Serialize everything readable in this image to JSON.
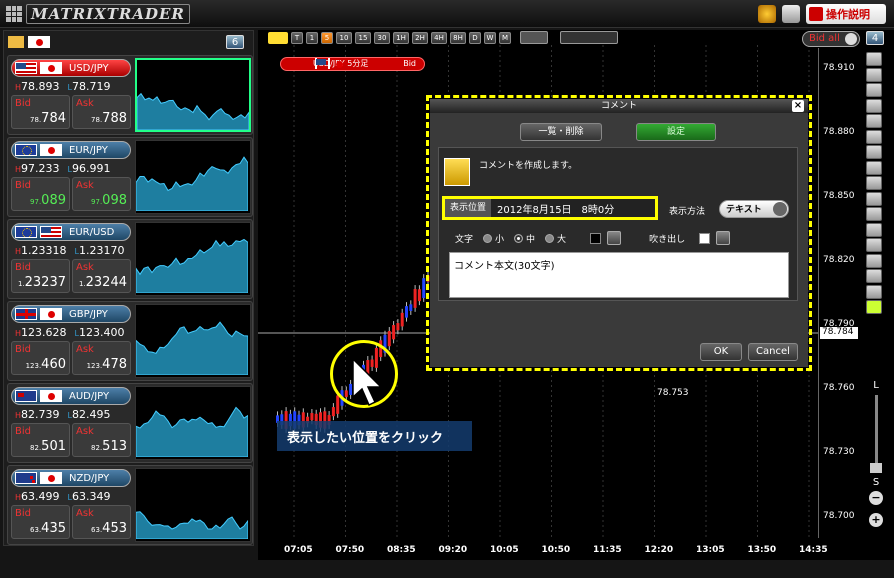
{
  "app": {
    "title": "MATRIXTRADER",
    "help_label": "操作説明"
  },
  "left_panel": {
    "count": "6",
    "pairs": [
      {
        "name": "USD/JPY",
        "flag1": "us",
        "flag2": "jp",
        "high": "78.893",
        "low": "78.719",
        "bid_prefix": "78.",
        "bid_main": "784",
        "ask_prefix": "78.",
        "ask_main": "788",
        "active": true
      },
      {
        "name": "EUR/JPY",
        "flag1": "eu",
        "flag2": "jp",
        "high": "97.233",
        "low": "96.991",
        "bid_prefix": "97.",
        "bid_main": "089",
        "ask_prefix": "97.",
        "ask_main": "098",
        "green": true
      },
      {
        "name": "EUR/USD",
        "flag1": "eu",
        "flag2": "us",
        "high": "1.23318",
        "low": "1.23170",
        "bid_prefix": "1.",
        "bid_main": "23237",
        "ask_prefix": "1.",
        "ask_main": "23244"
      },
      {
        "name": "GBP/JPY",
        "flag1": "gb",
        "flag2": "jp",
        "high": "123.628",
        "low": "123.400",
        "bid_prefix": "123.",
        "bid_main": "460",
        "ask_prefix": "123.",
        "ask_main": "478"
      },
      {
        "name": "AUD/JPY",
        "flag1": "au",
        "flag2": "jp",
        "high": "82.739",
        "low": "82.495",
        "bid_prefix": "82.",
        "bid_main": "501",
        "ask_prefix": "82.",
        "ask_main": "513"
      },
      {
        "name": "NZD/JPY",
        "flag1": "nz",
        "flag2": "jp",
        "high": "63.499",
        "low": "63.349",
        "bid_prefix": "63.",
        "bid_main": "435",
        "ask_prefix": "63.",
        "ask_main": "453"
      }
    ],
    "bid_label": "Bid",
    "ask_label": "Ask",
    "high_key": "H",
    "low_key": "L"
  },
  "chart": {
    "timeframes": [
      "T",
      "1",
      "5",
      "10",
      "15",
      "30",
      "1H",
      "2H",
      "4H",
      "8H",
      "D",
      "W",
      "M"
    ],
    "active_timeframe": "5",
    "bid_all_label": "Bid all",
    "chart_count": "4",
    "symbol_tag": "USD/JPY 5分足",
    "symbol_side": "Bid",
    "current_price": "78.784",
    "low_marker": "78.753",
    "callout": "表示したい位置をクリック",
    "zoom_l": "L",
    "zoom_s": "S"
  },
  "chart_data": {
    "type": "candlestick",
    "y_ticks": [
      "78.910",
      "78.880",
      "78.850",
      "78.820",
      "78.790",
      "78.760",
      "78.730",
      "78.700"
    ],
    "x_ticks": [
      "07:05",
      "07:50",
      "08:35",
      "09:20",
      "10:05",
      "10:50",
      "11:35",
      "12:20",
      "13:05",
      "13:50",
      "14:35"
    ],
    "ylim": [
      78.69,
      78.92
    ]
  },
  "dialog": {
    "title": "コメント",
    "list_delete_label": "一覧・削除",
    "settings_label": "設定",
    "message": "コメントを作成します。",
    "position_label": "表示位置",
    "position_value": "2012年8月15日　8時0分",
    "display_mode_label": "表示方法",
    "display_mode_value": "テキスト",
    "text_label": "文字",
    "size_small": "小",
    "size_medium": "中",
    "size_large": "大",
    "balloon_label": "吹き出し",
    "comment_placeholder": "コメント本文(30文字)",
    "ok_label": "OK",
    "cancel_label": "Cancel"
  }
}
